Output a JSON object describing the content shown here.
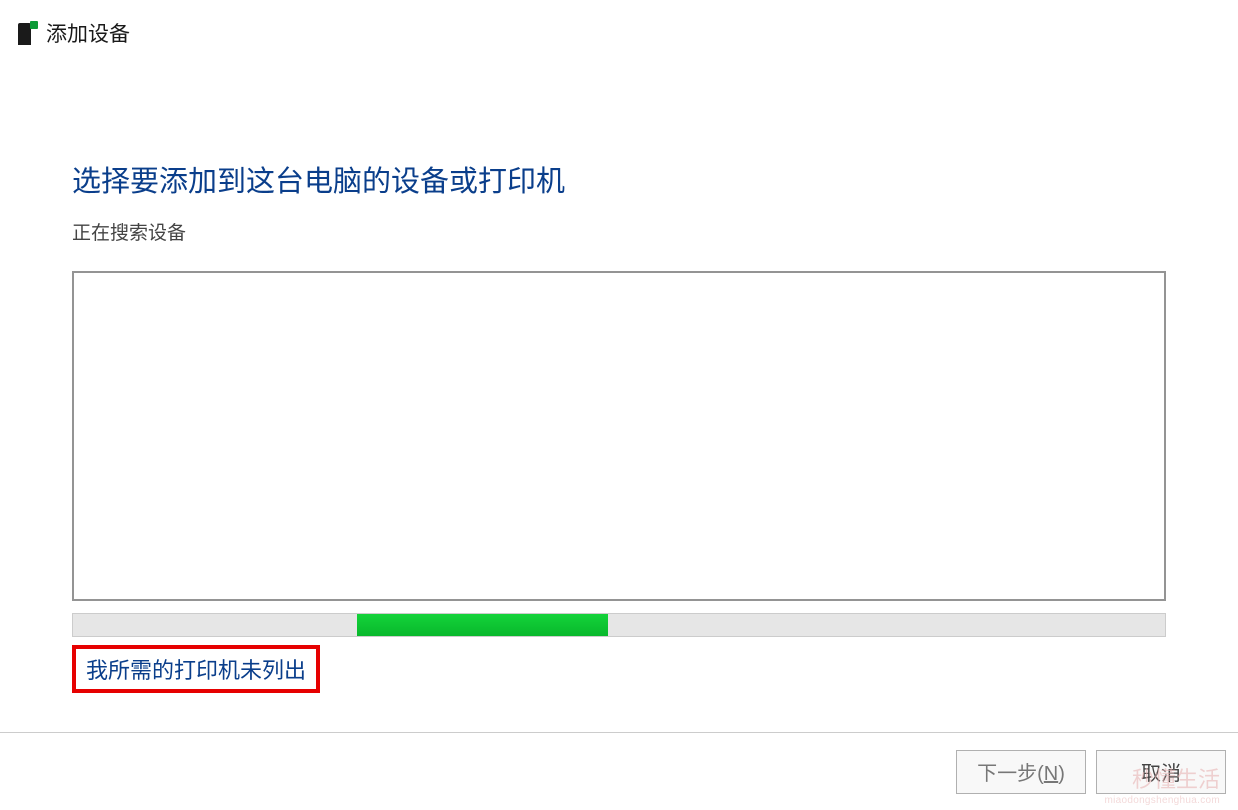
{
  "window": {
    "title": "添加设备"
  },
  "main": {
    "heading": "选择要添加到这台电脑的设备或打印机",
    "status": "正在搜索设备",
    "link": "我所需的打印机未列出"
  },
  "footer": {
    "next_label": "下一步(",
    "next_key": "N",
    "next_close": ")",
    "cancel_label": "取消"
  },
  "watermark": {
    "main": "秒懂生活",
    "sub": "miaodongshenghua.com"
  }
}
